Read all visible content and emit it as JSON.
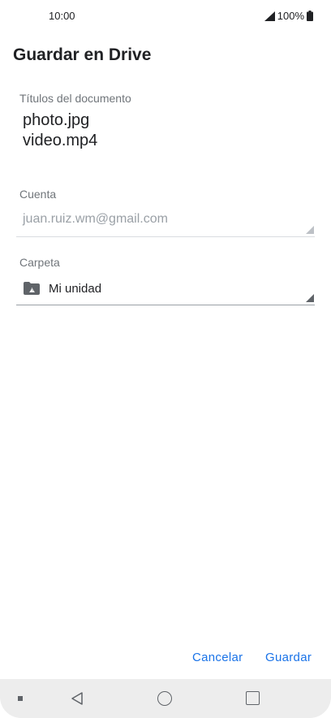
{
  "status_bar": {
    "time": "10:00",
    "battery": "100%",
    "icons": [
      "signal-icon",
      "battery-icon"
    ]
  },
  "dialog": {
    "title": "Guardar en Drive",
    "titles_label": "Títulos del documento",
    "documents": [
      "photo.jpg",
      "video.mp4"
    ],
    "account_label": "Cuenta",
    "account_value": "juan.ruiz.wm@gmail.com",
    "folder_label": "Carpeta",
    "folder_value": "Mi unidad",
    "folder_icon": "drive-folder-icon",
    "cancel_label": "Cancelar",
    "save_label": "Guardar",
    "accent_color": "#1a73e8"
  },
  "nav_bar": {
    "icons": [
      "square-dot-icon",
      "back-icon",
      "home-icon",
      "recents-icon"
    ]
  }
}
